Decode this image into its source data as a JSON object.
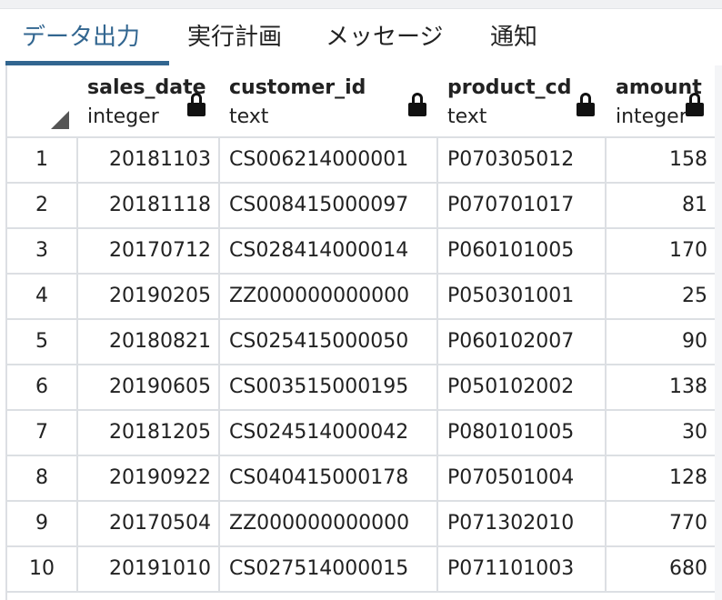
{
  "tabs": [
    {
      "label": "データ出力",
      "active": true
    },
    {
      "label": "実行計画",
      "active": false
    },
    {
      "label": "メッセージ",
      "active": false
    },
    {
      "label": "通知",
      "active": false
    }
  ],
  "columns": [
    {
      "name": "sales_date",
      "type": "integer",
      "lock_icon": "lock-icon"
    },
    {
      "name": "customer_id",
      "type": "text",
      "lock_icon": "lock-icon"
    },
    {
      "name": "product_cd",
      "type": "text",
      "lock_icon": "lock-icon"
    },
    {
      "name": "amount",
      "type": "integer",
      "lock_icon": "lock-icon"
    }
  ],
  "rows": [
    {
      "num": "1",
      "sales_date": "20181103",
      "customer_id": "CS006214000001",
      "product_cd": "P070305012",
      "amount": "158"
    },
    {
      "num": "2",
      "sales_date": "20181118",
      "customer_id": "CS008415000097",
      "product_cd": "P070701017",
      "amount": "81"
    },
    {
      "num": "3",
      "sales_date": "20170712",
      "customer_id": "CS028414000014",
      "product_cd": "P060101005",
      "amount": "170"
    },
    {
      "num": "4",
      "sales_date": "20190205",
      "customer_id": "ZZ000000000000",
      "product_cd": "P050301001",
      "amount": "25"
    },
    {
      "num": "5",
      "sales_date": "20180821",
      "customer_id": "CS025415000050",
      "product_cd": "P060102007",
      "amount": "90"
    },
    {
      "num": "6",
      "sales_date": "20190605",
      "customer_id": "CS003515000195",
      "product_cd": "P050102002",
      "amount": "138"
    },
    {
      "num": "7",
      "sales_date": "20181205",
      "customer_id": "CS024514000042",
      "product_cd": "P080101005",
      "amount": "30"
    },
    {
      "num": "8",
      "sales_date": "20190922",
      "customer_id": "CS040415000178",
      "product_cd": "P070501004",
      "amount": "128"
    },
    {
      "num": "9",
      "sales_date": "20170504",
      "customer_id": "ZZ000000000000",
      "product_cd": "P071302010",
      "amount": "770"
    },
    {
      "num": "10",
      "sales_date": "20191010",
      "customer_id": "CS027514000015",
      "product_cd": "P071101003",
      "amount": "680"
    }
  ],
  "colors": {
    "accent": "#326690",
    "grid_line": "#dcdfe3",
    "text": "#222222"
  }
}
